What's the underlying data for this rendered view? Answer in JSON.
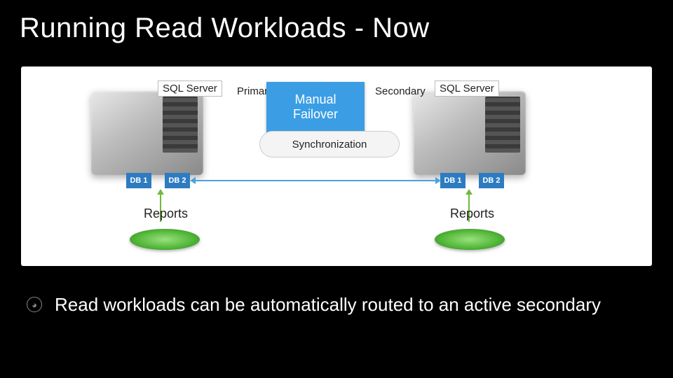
{
  "title": "Running Read Workloads - Now",
  "servers": {
    "left_label": "SQL Server",
    "right_label": "SQL Server",
    "role_a": "Primary",
    "role_b": "Secondary"
  },
  "failover": {
    "line1": "Manual",
    "line2": "Failover"
  },
  "sync_label": "Synchronization",
  "dbs": {
    "l1": "DB 1",
    "l2": "DB 2",
    "r1": "DB 1",
    "r2": "DB 2"
  },
  "reports": {
    "left": "Reports",
    "right": "Reports"
  },
  "footer": {
    "icon": "◕",
    "text": "Read workloads can be automatically routed to an active secondary"
  }
}
